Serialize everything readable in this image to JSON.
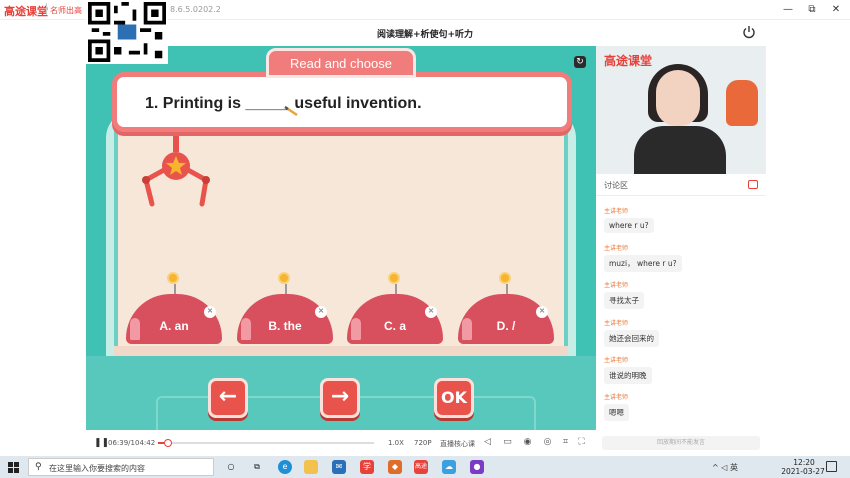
{
  "titlebar": {
    "logo": "高途课堂",
    "slogan": "名师出高",
    "version": "8.6.5.0202.2",
    "minimize": "—",
    "restore": "⧉",
    "close": "✕"
  },
  "header": {
    "lesson_title": "阅读理解+析使句+听力"
  },
  "stage": {
    "tab_title": "Read and choose",
    "question": "1. Printing is _____ useful invention.",
    "options": [
      {
        "label": "A. an"
      },
      {
        "label": "B. the"
      },
      {
        "label": "C. a"
      },
      {
        "label": "D. /"
      }
    ],
    "prev_arrow": "←",
    "next_arrow": "→",
    "ok_label": "OK"
  },
  "player": {
    "time": "06:39/104:42",
    "speed": "1.0X",
    "quality": "720P",
    "mode": "直播核心课",
    "progress_fraction": 0.03
  },
  "right_panel": {
    "video_logo": "高途课堂",
    "chat_title": "讨论区",
    "messages": [
      {
        "role": "主讲老师",
        "text": "where r u?"
      },
      {
        "role": "主讲老师",
        "text": "muzi， where r u?"
      },
      {
        "role": "主讲老师",
        "text": "寻找太子"
      },
      {
        "role": "主讲老师",
        "text": "她还会回来的"
      },
      {
        "role": "主讲老师",
        "text": "谁说的明晚"
      },
      {
        "role": "主讲老师",
        "text": "嗯嗯"
      }
    ],
    "chat_input_placeholder": "回放期间不能发言"
  },
  "taskbar": {
    "search_placeholder": "在这里输入你要搜索的内容",
    "tray": "^ ◁ 英",
    "time": "12:20",
    "date": "2021-03-27",
    "colors": {
      "accent": "#e8413a",
      "stage": "#3fc1b4",
      "dome": "#d84f5d"
    }
  }
}
